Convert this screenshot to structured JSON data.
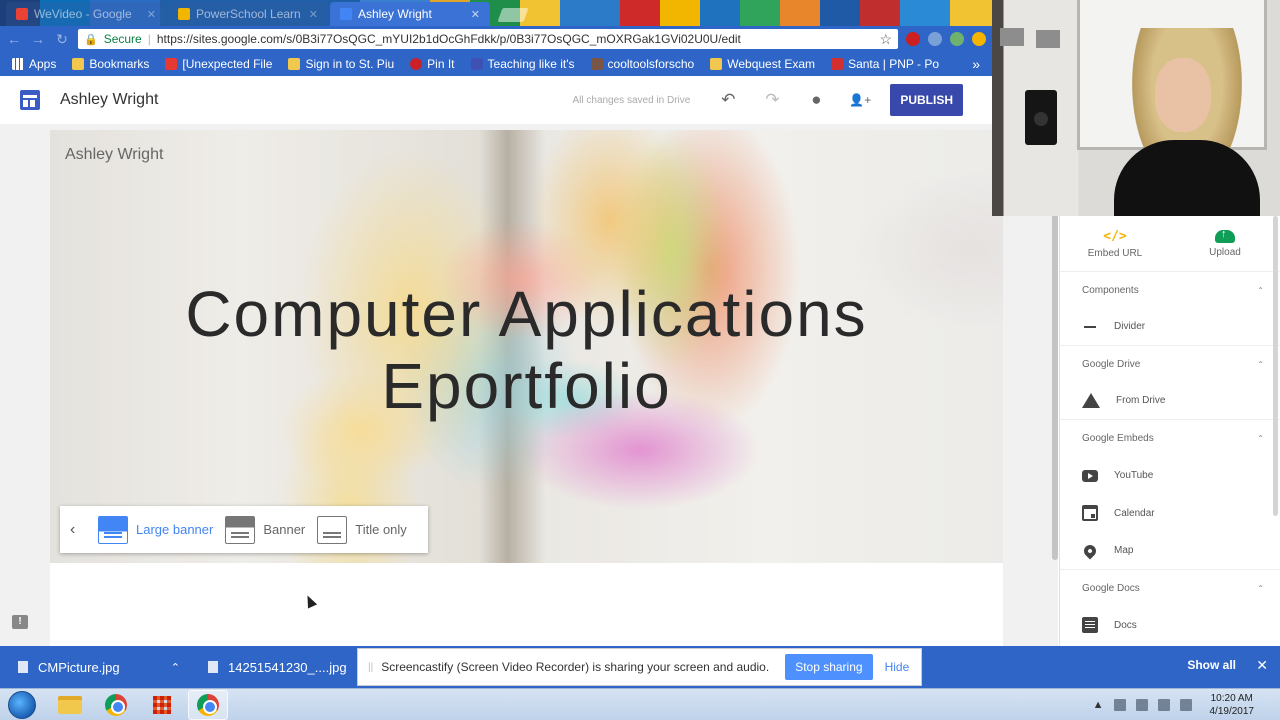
{
  "browser": {
    "tabs": [
      {
        "title": "WeVideo - Google",
        "favicon_color": "#ea4335",
        "active": false
      },
      {
        "title": "PowerSchool Learn",
        "favicon_color": "#f2b600",
        "active": false
      },
      {
        "title": "Ashley Wright",
        "favicon_color": "#4285f4",
        "active": true
      }
    ],
    "secure_label": "Secure",
    "url": "https://sites.google.com/s/0B3i77OsQGC_mYUI2b1dOcGhFdkk/p/0B3i77OsQGC_mOXRGak1GVi02U0U/edit",
    "bookmarks": [
      {
        "label": "Apps",
        "icon": "apps-grid-icon",
        "color": "#ffffff"
      },
      {
        "label": "Bookmarks",
        "icon": "folder-icon",
        "color": "#f1c84b"
      },
      {
        "label": "[Unexpected File",
        "icon": "acrobat-icon",
        "color": "#e53935"
      },
      {
        "label": "Sign in to St. Piu",
        "icon": "folder-icon",
        "color": "#f1c84b"
      },
      {
        "label": "Pin It",
        "icon": "pin-icon",
        "color": "#cb2027"
      },
      {
        "label": "Teaching like it's",
        "icon": "blog-icon",
        "color": "#3f51b5"
      },
      {
        "label": "cooltoolsforscho",
        "icon": "site-icon",
        "color": "#795548"
      },
      {
        "label": "Webquest Exam",
        "icon": "folder-icon",
        "color": "#f1c84b"
      },
      {
        "label": "Santa | PNP - Po",
        "icon": "santa-icon",
        "color": "#d32f2f"
      }
    ]
  },
  "sites": {
    "site_name": "Ashley Wright",
    "save_status": "All changes saved in Drive",
    "publish_label": "PUBLISH",
    "icons": {
      "undo": "↶",
      "redo": "↷",
      "preview": "👁",
      "share": "👤+"
    },
    "banner": {
      "site_name": "Ashley Wright",
      "title_line1": "Computer Applications",
      "title_line2": "Eportfolio"
    },
    "header_types": {
      "back": "‹",
      "options": [
        {
          "label": "Large banner",
          "selected": true
        },
        {
          "label": "Banner",
          "selected": false
        },
        {
          "label": "Title only",
          "selected": false
        }
      ]
    },
    "insert_panel": {
      "embed_url_label": "Embed URL",
      "embed_icon": "</>",
      "upload_label": "Upload",
      "sections": [
        {
          "title": "Components",
          "items": [
            {
              "label": "Divider",
              "icon": "divider"
            }
          ]
        },
        {
          "title": "Google Drive",
          "items": [
            {
              "label": "From Drive",
              "icon": "drive"
            }
          ]
        },
        {
          "title": "Google Embeds",
          "items": [
            {
              "label": "YouTube",
              "icon": "youtube"
            },
            {
              "label": "Calendar",
              "icon": "calendar"
            },
            {
              "label": "Map",
              "icon": "map"
            }
          ]
        },
        {
          "title": "Google Docs",
          "items": [
            {
              "label": "Docs",
              "icon": "docs"
            }
          ]
        }
      ]
    }
  },
  "downloads": {
    "items": [
      {
        "name": "CMPicture.jpg"
      },
      {
        "name": "14251541230_....jpg"
      }
    ],
    "share_message": "Screencastify (Screen Video Recorder) is sharing your screen and audio.",
    "stop_sharing": "Stop sharing",
    "hide": "Hide",
    "show_all": "Show all",
    "close": "✕"
  },
  "taskbar": {
    "time": "10:20 AM",
    "date": "4/19/2017"
  }
}
